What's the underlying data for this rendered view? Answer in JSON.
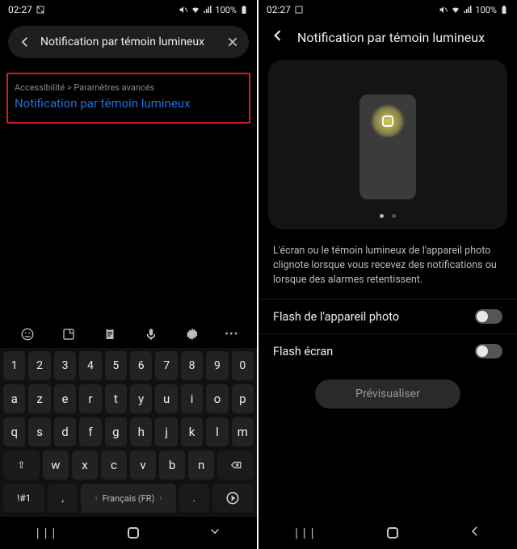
{
  "status": {
    "time": "02:27",
    "battery_pct": "100%"
  },
  "left": {
    "search_value": "Notification par témoin lumineux",
    "result": {
      "breadcrumb": "Accessibilité > Paramètres avancés",
      "title": "Notification par témoin lumineux"
    },
    "keyboard": {
      "rows_num": [
        "1",
        "2",
        "3",
        "4",
        "5",
        "6",
        "7",
        "8",
        "9",
        "0"
      ],
      "rows_top": [
        "a",
        "z",
        "e",
        "r",
        "t",
        "y",
        "u",
        "i",
        "o",
        "p"
      ],
      "rows_mid": [
        "q",
        "s",
        "d",
        "f",
        "g",
        "h",
        "j",
        "k",
        "l",
        "m"
      ],
      "rows_bot": [
        "w",
        "x",
        "c",
        "v",
        "b",
        "n"
      ],
      "shift_label": "⇧",
      "sym_label": "!#1",
      "comma": ",",
      "space_label": "Français (FR)",
      "dot": ".",
      "enter_label": "↵"
    }
  },
  "right": {
    "title": "Notification par témoin lumineux",
    "description": "L'écran ou le témoin lumineux de l'appareil photo clignote lorsque vous recevez des notifications ou lorsque des alarmes retentissent.",
    "settings": [
      {
        "label": "Flash de l'appareil photo",
        "on": false
      },
      {
        "label": "Flash écran",
        "on": false
      }
    ],
    "preview_btn": "Prévisualiser"
  }
}
